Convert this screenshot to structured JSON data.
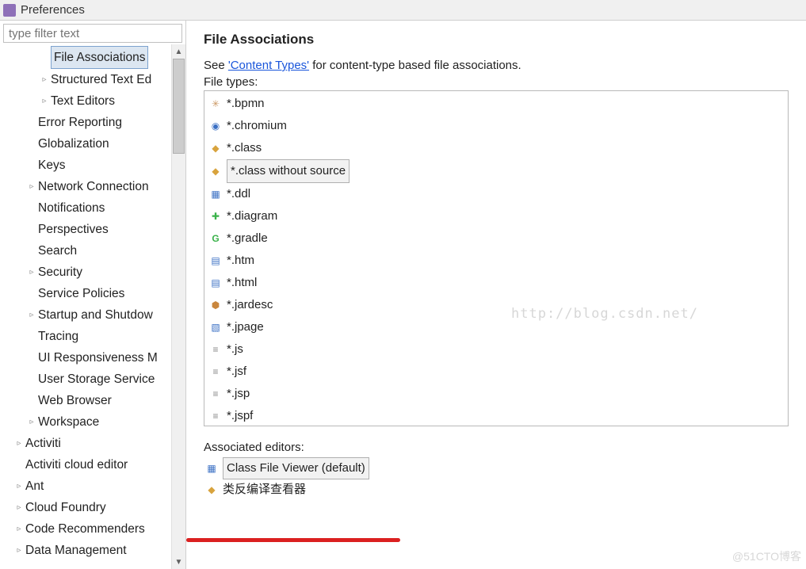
{
  "window": {
    "title": "Preferences"
  },
  "sidebar": {
    "filter_placeholder": "type filter text",
    "selected": "File Associations",
    "nodes": [
      {
        "label": "File Associations",
        "depth": 3,
        "expand": "",
        "selected": true
      },
      {
        "label": "Structured Text Ed",
        "depth": 3,
        "expand": "▹"
      },
      {
        "label": "Text Editors",
        "depth": 3,
        "expand": "▹"
      },
      {
        "label": "Error Reporting",
        "depth": 2,
        "expand": ""
      },
      {
        "label": "Globalization",
        "depth": 2,
        "expand": ""
      },
      {
        "label": "Keys",
        "depth": 2,
        "expand": ""
      },
      {
        "label": "Network Connection",
        "depth": 2,
        "expand": "▹"
      },
      {
        "label": "Notifications",
        "depth": 2,
        "expand": ""
      },
      {
        "label": "Perspectives",
        "depth": 2,
        "expand": ""
      },
      {
        "label": "Search",
        "depth": 2,
        "expand": ""
      },
      {
        "label": "Security",
        "depth": 2,
        "expand": "▹"
      },
      {
        "label": "Service Policies",
        "depth": 2,
        "expand": ""
      },
      {
        "label": "Startup and Shutdow",
        "depth": 2,
        "expand": "▹"
      },
      {
        "label": "Tracing",
        "depth": 2,
        "expand": ""
      },
      {
        "label": "UI Responsiveness M",
        "depth": 2,
        "expand": ""
      },
      {
        "label": "User Storage Service",
        "depth": 2,
        "expand": ""
      },
      {
        "label": "Web Browser",
        "depth": 2,
        "expand": ""
      },
      {
        "label": "Workspace",
        "depth": 2,
        "expand": "▹"
      },
      {
        "label": "Activiti",
        "depth": 1,
        "expand": "▹"
      },
      {
        "label": "Activiti cloud editor",
        "depth": 1,
        "expand": ""
      },
      {
        "label": "Ant",
        "depth": 1,
        "expand": "▹"
      },
      {
        "label": "Cloud Foundry",
        "depth": 1,
        "expand": "▹"
      },
      {
        "label": "Code Recommenders",
        "depth": 1,
        "expand": "▹"
      },
      {
        "label": "Data Management",
        "depth": 1,
        "expand": "▹"
      }
    ]
  },
  "page": {
    "title": "File Associations",
    "desc_prefix": "See ",
    "desc_link": "'Content Types'",
    "desc_suffix": " for content-type based file associations.",
    "file_types_label": "File types:",
    "file_types": [
      {
        "label": "*.bpmn",
        "icon": "✳",
        "iclass": "i-bpmn"
      },
      {
        "label": "*.chromium",
        "icon": "◉",
        "iclass": "i-chrome"
      },
      {
        "label": "*.class",
        "icon": "◆",
        "iclass": "i-class"
      },
      {
        "label": "*.class without source",
        "icon": "◆",
        "iclass": "i-class",
        "selected": true
      },
      {
        "label": "*.ddl",
        "icon": "▦",
        "iclass": "i-ddl"
      },
      {
        "label": "*.diagram",
        "icon": "✚",
        "iclass": "i-diagram"
      },
      {
        "label": "*.gradle",
        "icon": "G",
        "iclass": "i-gradle"
      },
      {
        "label": "*.htm",
        "icon": "▤",
        "iclass": "i-web"
      },
      {
        "label": "*.html",
        "icon": "▤",
        "iclass": "i-web"
      },
      {
        "label": "*.jardesc",
        "icon": "⬢",
        "iclass": "i-jar"
      },
      {
        "label": "*.jpage",
        "icon": "▧",
        "iclass": "i-page"
      },
      {
        "label": "*.js",
        "icon": "≡",
        "iclass": "i-txt"
      },
      {
        "label": "*.jsf",
        "icon": "≡",
        "iclass": "i-txt"
      },
      {
        "label": "*.jsp",
        "icon": "≡",
        "iclass": "i-txt"
      },
      {
        "label": "*.jspf",
        "icon": "≡",
        "iclass": "i-txt"
      }
    ],
    "assoc_label": "Associated editors:",
    "editors": [
      {
        "label": "Class File Viewer (default)",
        "icon": "▦",
        "iclass": "i-ddl",
        "selected": true
      },
      {
        "label": "类反编译查看器",
        "icon": "◆",
        "iclass": "i-class"
      }
    ]
  },
  "watermark": "http://blog.csdn.net/",
  "watermark2": "@51CTO博客"
}
